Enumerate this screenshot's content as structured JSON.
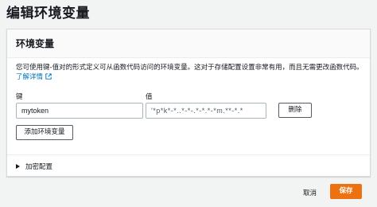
{
  "page": {
    "title": "编辑环境变量"
  },
  "panel": {
    "header": "环境变量",
    "description": "您可使用键-值对的形式定义可从函数代码访问的环境变量。这对于存储配置设置非常有用，而且无需更改函数代码。",
    "learn_more": "了解详情"
  },
  "variables": {
    "key_label": "键",
    "value_label": "值",
    "rows": [
      {
        "key": "mytoken",
        "value": "'*p*k*-*..*-*-.*-*.*-*m.**-*.*"
      }
    ],
    "remove_label": "删除",
    "add_label": "添加环境变量"
  },
  "encryption": {
    "label": "加密配置"
  },
  "footer": {
    "cancel_label": "取消",
    "save_label": "保存"
  },
  "colors": {
    "primary": "#ec7211",
    "link": "#0073bb"
  },
  "icons": {
    "external_link": "external-link-icon",
    "expand": "caret-right-icon"
  }
}
